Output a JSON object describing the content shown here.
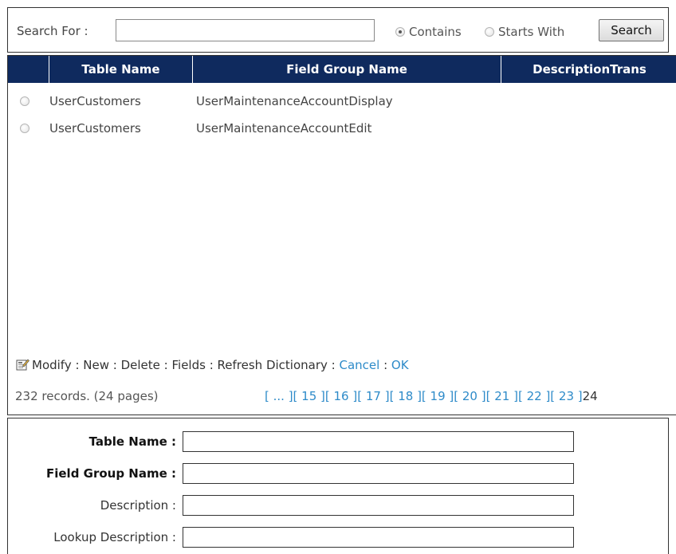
{
  "search": {
    "label": "Search For :",
    "input_value": "",
    "options": [
      {
        "label": "Contains",
        "checked": true
      },
      {
        "label": "Starts With",
        "checked": false
      }
    ],
    "button_label": "Search"
  },
  "grid": {
    "columns": [
      "Table Name",
      "Field Group Name",
      "DescriptionTrans"
    ],
    "rows": [
      {
        "table_name": "UserCustomers",
        "field_group_name": "UserMaintenanceAccountDisplay",
        "description": ""
      },
      {
        "table_name": "UserCustomers",
        "field_group_name": "UserMaintenanceAccountEdit",
        "description": ""
      }
    ],
    "actions": {
      "icon": "edit-form-icon",
      "modify": "Modify",
      "new": "New",
      "delete": "Delete",
      "fields": "Fields",
      "refresh": "Refresh Dictionary",
      "cancel": "Cancel",
      "ok": "OK",
      "separator": " : "
    },
    "records_text": "232 records. (24 pages)",
    "pager": {
      "prev": "[ ... ]",
      "pages": [
        "15",
        "16",
        "17",
        "18",
        "19",
        "20",
        "21",
        "22",
        "23"
      ],
      "current": "24"
    },
    "link_color": "#2e8bc9",
    "header_color": "#0f2a5e"
  },
  "form": {
    "fields": [
      {
        "label": "Table Name :",
        "bold": true,
        "value": ""
      },
      {
        "label": "Field Group Name :",
        "bold": true,
        "value": ""
      },
      {
        "label": "Description :",
        "bold": false,
        "value": ""
      },
      {
        "label": "Lookup Description :",
        "bold": false,
        "value": ""
      }
    ]
  }
}
